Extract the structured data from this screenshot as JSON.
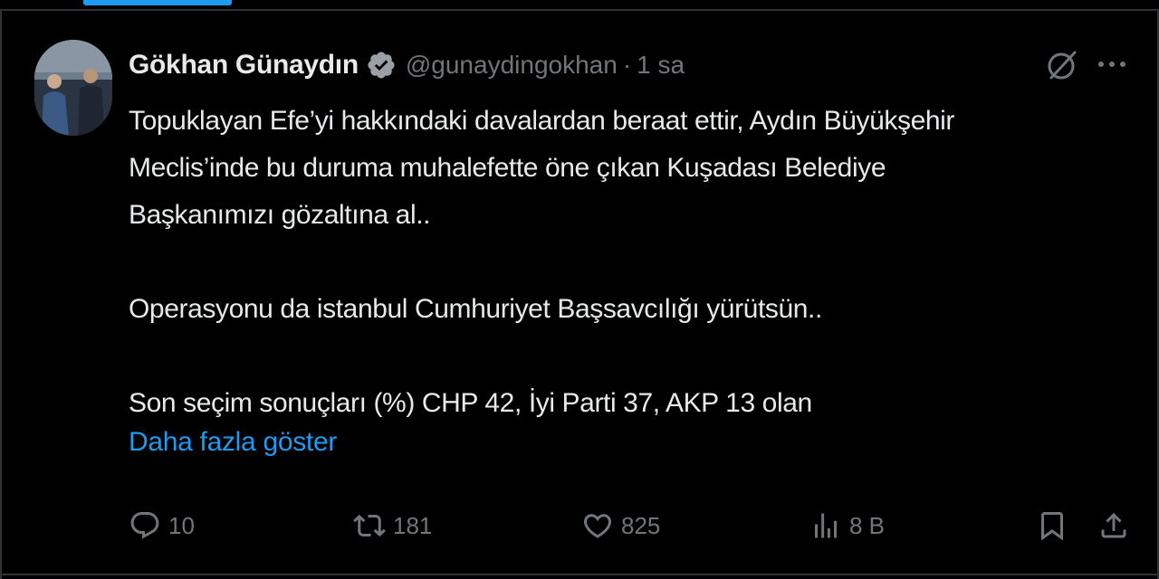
{
  "tweet": {
    "author_name": "Gökhan Günaydın",
    "handle": "@gunaydingokhan",
    "separator": "·",
    "time": "1 sa",
    "lines": {
      "l1": "Topuklayan Efe’yi hakkındaki davalardan beraat ettir, Aydın Büyükşehir",
      "l2": "Meclis’inde bu duruma muhalefette öne çıkan Kuşadası Belediye",
      "l3": "Başkanımızı gözaltına al..",
      "l4": "Operasyonu da istanbul Cumhuriyet Başsavcılığı yürütsün..",
      "l5": "Son seçim sonuçları (%) CHP 42, İyi Parti 37, AKP 13 olan"
    },
    "show_more": "Daha fazla göster"
  },
  "actions": {
    "replies": "10",
    "reposts": "181",
    "likes": "825",
    "views": "8 B"
  },
  "icons": {
    "verified": "verified-badge-icon",
    "grok": "grok-icon",
    "more": "more-icon",
    "reply": "reply-icon",
    "repost": "repost-icon",
    "like": "heart-icon",
    "views": "views-icon",
    "bookmark": "bookmark-icon",
    "share": "share-icon"
  },
  "colors": {
    "background": "#000000",
    "text": "#e7e9ea",
    "muted": "#71767b",
    "accent": "#1d9bf0"
  }
}
